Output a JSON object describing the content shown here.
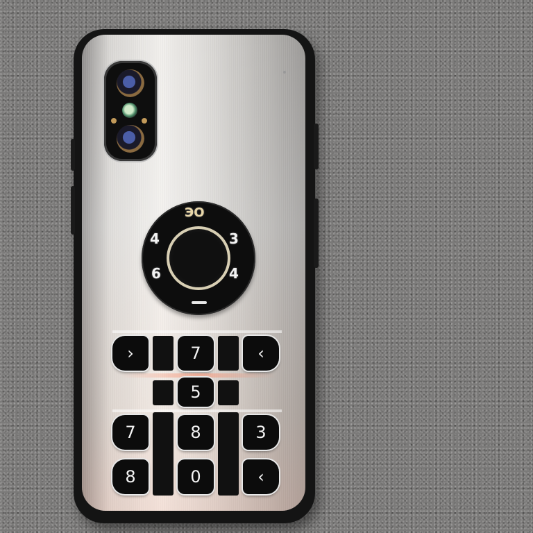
{
  "dial": {
    "top": "ЭО",
    "top_left": "4",
    "top_right": "3",
    "bottom_left": "6",
    "bottom_right": "4"
  },
  "keypad": {
    "row1": [
      "›",
      "7",
      "‹"
    ],
    "row2": [
      "5"
    ],
    "row3": [
      "7",
      "8",
      "3"
    ],
    "row4": [
      "8",
      "0",
      "‹"
    ]
  },
  "colors": {
    "background": "#7b7a79",
    "phone_body": "#141414",
    "keys": "#0c0c0c"
  }
}
